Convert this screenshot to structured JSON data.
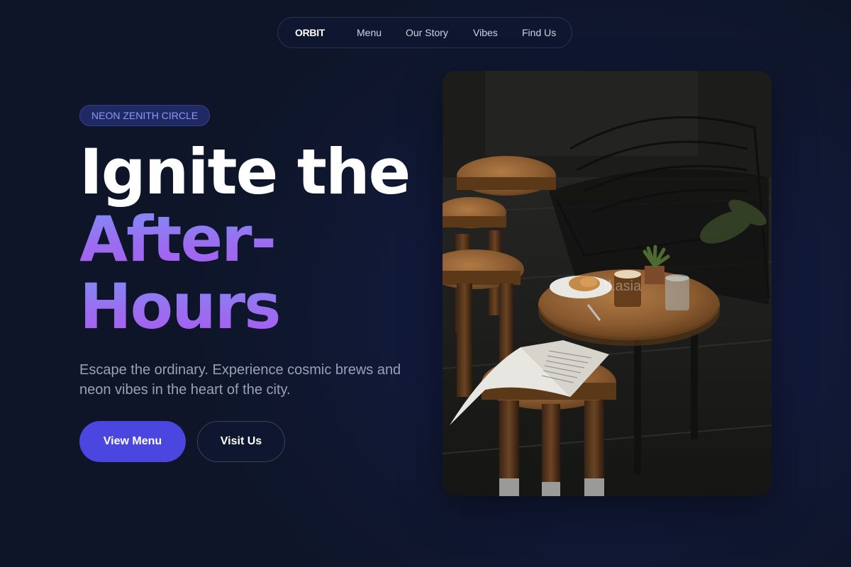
{
  "nav": {
    "brand": "ORBIT",
    "links": [
      "Menu",
      "Our Story",
      "Vibes",
      "Find Us"
    ]
  },
  "hero": {
    "badge": "NEON ZENITH CIRCLE",
    "headline_line1": "Ignite the",
    "headline_line2": "After-",
    "headline_line3": "Hours",
    "subtitle": "Escape the ordinary. Experience cosmic brews and neon vibes in the heart of the city.",
    "primary_button": "View Menu",
    "secondary_button": "Visit Us"
  },
  "image": {
    "watermark": "tl.asia"
  },
  "colors": {
    "background": "#0f172f",
    "accent": "#4c46e0",
    "gradient_start": "#7f8df6",
    "gradient_end": "#a95cf0",
    "badge_text": "#8c99ee",
    "subtitle": "#98a1b8"
  }
}
